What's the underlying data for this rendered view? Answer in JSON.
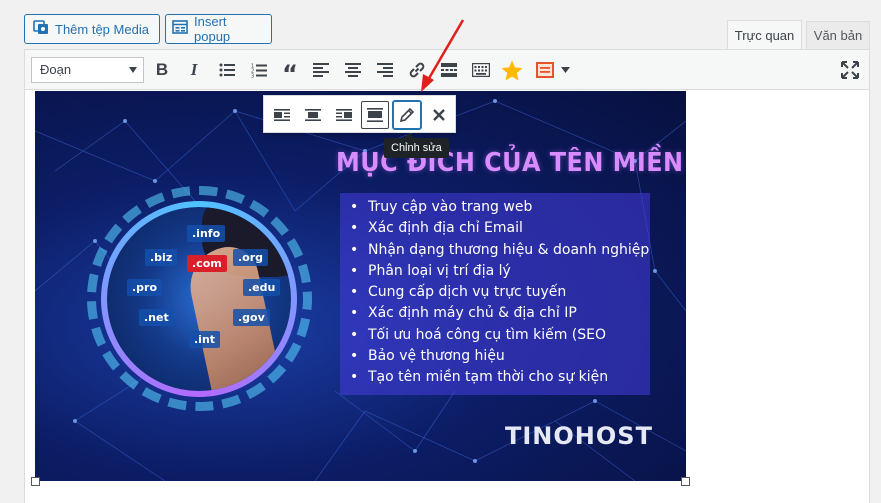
{
  "media_buttons": {
    "add_media": "Thêm tệp Media",
    "insert_popup": "Insert popup"
  },
  "tabs": {
    "visual": "Trực quan",
    "text": "Văn bản"
  },
  "toolbar": {
    "format_select": "Đoạn",
    "buttons": [
      "bold",
      "italic",
      "bulleted-list",
      "numbered-list",
      "blockquote",
      "align-left",
      "align-center",
      "align-right",
      "insert-link",
      "read-more",
      "toolbar-toggle",
      "star",
      "shortcode",
      "dropdown",
      "fullscreen"
    ]
  },
  "image_toolbar": {
    "tooltip": "Chỉnh sửa"
  },
  "image": {
    "title": "MỤC ĐÍCH CỦA TÊN MIỀN",
    "list": [
      "Truy cập vào trang web",
      "Xác định địa chỉ Email",
      "Nhận dạng thương hiệu & doanh nghiệp",
      "Phân loại vị trí địa lý",
      "Cung cấp dịch vụ trực tuyến",
      "Xác định máy chủ & địa chỉ IP",
      "Tối ưu hoá công cụ tìm kiếm (SEO",
      "Bảo vệ thương hiệu",
      "Tạo tên miền tạm thời cho sự kiện"
    ],
    "tlds": [
      ".info",
      ".biz",
      ".com",
      ".org",
      ".pro",
      ".edu",
      ".net",
      ".gov",
      ".int"
    ],
    "brand": "TINOHOST"
  },
  "colors": {
    "accent": "#2271b1",
    "arrow": "#e0201c",
    "star": "#ffb900",
    "shortcode": "#e5532b"
  }
}
